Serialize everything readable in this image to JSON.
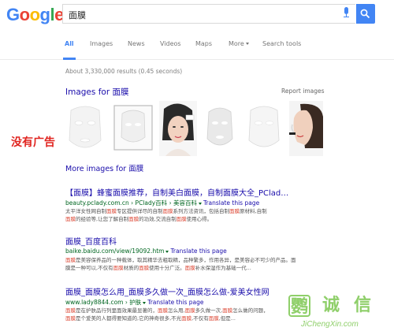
{
  "header": {
    "logo_letters": [
      {
        "ch": "G",
        "color": "#4285f4"
      },
      {
        "ch": "o",
        "color": "#ea4335"
      },
      {
        "ch": "o",
        "color": "#fbbc05"
      },
      {
        "ch": "g",
        "color": "#4285f4"
      },
      {
        "ch": "l",
        "color": "#34a853"
      },
      {
        "ch": "e",
        "color": "#ea4335"
      }
    ],
    "query": "面膜"
  },
  "tabs": [
    "All",
    "Images",
    "News",
    "Videos",
    "Maps",
    "More",
    "Search tools"
  ],
  "stats": "About 3,330,000 results (0.45 seconds)",
  "images_block": {
    "title": "Images for 面膜",
    "report": "Report images",
    "more": "More images for 面膜"
  },
  "ad_label": "没有广告",
  "results": [
    {
      "title": "【面膜】蜂蜜面膜推荐，自制美白面膜，自制面膜大全_PClad…",
      "url": "beauty.pclady.com.cn › PClady百科 › 美容百科",
      "translate": "Translate this page",
      "snippet_1": "太平洋女性网自制面膜专区提供详尽的自制面膜系列方法资讯，包括自制面膜原材料,自制",
      "snippet_2": "面膜的经验等,让您了解自制面膜的功效,交流自制面膜使用心得。"
    },
    {
      "title": "面膜_百度百科",
      "url": "baike.baidu.com/view/19092.htm",
      "translate": "Translate this page",
      "snippet_1": "面膜是美容保养品的一种载体，取其精华去粗取精，品种繁多，作用各异，是美容必不可少的产品。面",
      "snippet_2": "膜是一种可以,不仅有面膜材质的面膜使用十分广泛。面膜补水保湿作为基础一代..."
    },
    {
      "title": "面膜_面膜怎么用_面膜多久做一次_面膜怎么做-爱美女性网",
      "url": "www.lady8844.com › 护肤",
      "translate": "Translate this page",
      "snippet_1": "面膜是在护肤品行列里面效果最显著的，面膜怎么用,面膜多久做一次,面膜怎么做的问题，",
      "snippet_2": "面膜是个爱美的人都得要知道的,它的神奇很多,不光面膜,不仅有面膜,但是..."
    }
  ],
  "watermark": {
    "chars": [
      "鹦",
      "诚",
      "信"
    ],
    "url": "JiChengXin.com"
  }
}
